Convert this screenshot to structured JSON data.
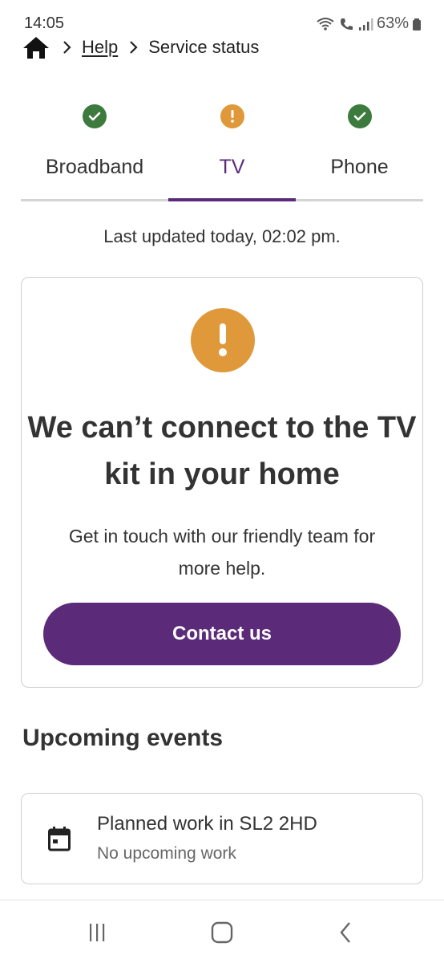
{
  "status_bar": {
    "time": "14:05",
    "battery": "63%",
    "icons": [
      "wifi-calling-icon",
      "volte-icon",
      "signal-icon",
      "battery-icon"
    ]
  },
  "breadcrumb": {
    "home_icon": "home-icon",
    "help": "Help",
    "current": "Service status"
  },
  "tabs": [
    {
      "label": "Broadband",
      "status": "ok",
      "status_icon": "check-icon",
      "color": "#3d7a3d"
    },
    {
      "label": "TV",
      "status": "warning",
      "status_icon": "exclamation-icon",
      "color": "#e0993a",
      "active": true
    },
    {
      "label": "Phone",
      "status": "ok",
      "status_icon": "check-icon",
      "color": "#3d7a3d"
    }
  ],
  "last_updated": "Last updated today, 02:02 pm.",
  "alert": {
    "icon": "exclamation-icon",
    "color": "#e0993a",
    "title": "We can’t connect to the TV kit in your home",
    "body": "Get in touch with our friendly team for more help.",
    "button": "Contact us"
  },
  "upcoming": {
    "title": "Upcoming events",
    "event": {
      "icon": "calendar-icon",
      "title": "Planned work in SL2 2HD",
      "subtitle": "No upcoming work"
    }
  },
  "colors": {
    "brand": "#5b2b7a",
    "ok": "#3d7a3d",
    "warning": "#e0993a"
  },
  "nav": [
    "recent-apps-icon",
    "home-button-icon",
    "back-icon"
  ]
}
